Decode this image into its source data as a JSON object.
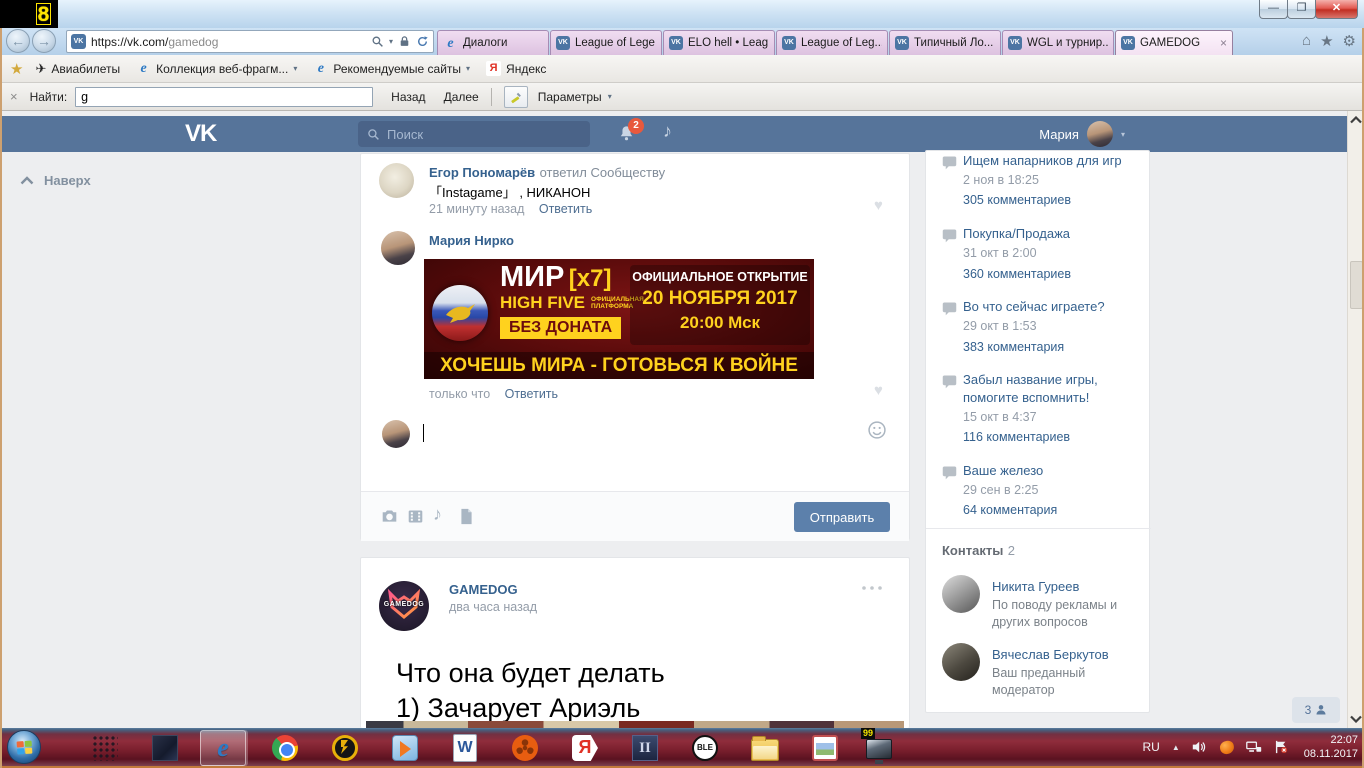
{
  "overlay": {
    "fps_counter": "8"
  },
  "icons": {
    "close": "×",
    "caret": "▾",
    "home": "⌂",
    "star": "★",
    "gear": "⚙",
    "heart": "♥",
    "note": "♪",
    "airplane": "✈",
    "ie": "e",
    "yandex": "Я",
    "vk": "VK",
    "back": "←",
    "forward": "→",
    "up_small": "▲",
    "tab_close": "×"
  },
  "browser": {
    "address": {
      "url_host": "https://vk.com/",
      "url_path": "gamedog"
    },
    "tabs": [
      {
        "label": "Диалоги"
      },
      {
        "label": "League of Lege..."
      },
      {
        "label": "ELO hell • Leag..."
      },
      {
        "label": "League of Leg..."
      },
      {
        "label": "Типичный Ло..."
      },
      {
        "label": "WGL и турнир..."
      },
      {
        "label": "GAMEDOG"
      }
    ],
    "favorites_bar": {
      "items": [
        {
          "label": "Авиабилеты"
        },
        {
          "label": "Коллекция веб-фрагм..."
        },
        {
          "label": "Рекомендуемые сайты"
        },
        {
          "label": "Яндекс"
        }
      ]
    },
    "find_bar": {
      "label": "Найти:",
      "value": "g",
      "back": "Назад",
      "forward": "Далее",
      "options": "Параметры"
    }
  },
  "vk": {
    "header": {
      "logo": "VK",
      "search_placeholder": "Поиск",
      "notifications": "2",
      "user": "Мария"
    },
    "back_to_top": "Наверх",
    "comments": [
      {
        "author": "Егор Пономарёв",
        "action": "ответил Сообществу",
        "text": "「Instagame」 , НИКАНОН",
        "time": "21 минуту назад",
        "reply": "Ответить"
      },
      {
        "author": "Мария Нирко",
        "time": "только что",
        "reply": "Ответить"
      }
    ],
    "banner": {
      "game": "МИР",
      "rate": "[x7]",
      "server": "HIGH FIVE",
      "platform_line1": "ОФИЦИАЛЬНАЯ",
      "platform_line2": "ПЛАТФОРМА",
      "no_donate": "БЕЗ ДОНАТА",
      "opening": "ОФИЦИАЛЬНОЕ ОТКРЫТИЕ",
      "date": "20 НОЯБРЯ 2017",
      "time": "20:00 Мск",
      "slogan": "ХОЧЕШЬ МИРА - ГОТОВЬСЯ К ВОЙНЕ"
    },
    "reply_form": {
      "send": "Отправить"
    },
    "post": {
      "author": "GAMEDOG",
      "avatar_text": "GAMEDOG",
      "time": "два часа назад",
      "text_line1": "Что она будет делать",
      "text_line2": "1) Зачарует Ариэль"
    },
    "topics": [
      {
        "title": "Ищем напарников для игр",
        "date": "2 ноя в 18:25",
        "comments": "305 комментариев"
      },
      {
        "title": "Покупка/Продажа",
        "date": "31 окт в 2:00",
        "comments": "360 комментариев"
      },
      {
        "title": "Во что сейчас играете?",
        "date": "29 окт в 1:53",
        "comments": "383 комментария"
      },
      {
        "title": "Забыл название игры, помогите вспомнить!",
        "date": "15 окт в 4:37",
        "comments": "116 комментариев"
      },
      {
        "title": "Ваше железо",
        "date": "29 сен в 2:25",
        "comments": "64 комментария"
      }
    ],
    "contacts": {
      "title": "Контакты",
      "count": "2",
      "items": [
        {
          "name": "Никита Гуреев",
          "desc": "По поводу рекламы и других вопросов"
        },
        {
          "name": "Вячеслав Беркутов",
          "desc": "Ваш преданный модератор"
        }
      ]
    },
    "online_count": "3"
  },
  "taskbar": {
    "word_glyph": "W",
    "lineage_glyph": "II",
    "ble_glyph": "BLE",
    "monitor_badge": "99",
    "tray": {
      "lang": "RU",
      "time": "22:07",
      "date": "08.11.2017"
    }
  }
}
